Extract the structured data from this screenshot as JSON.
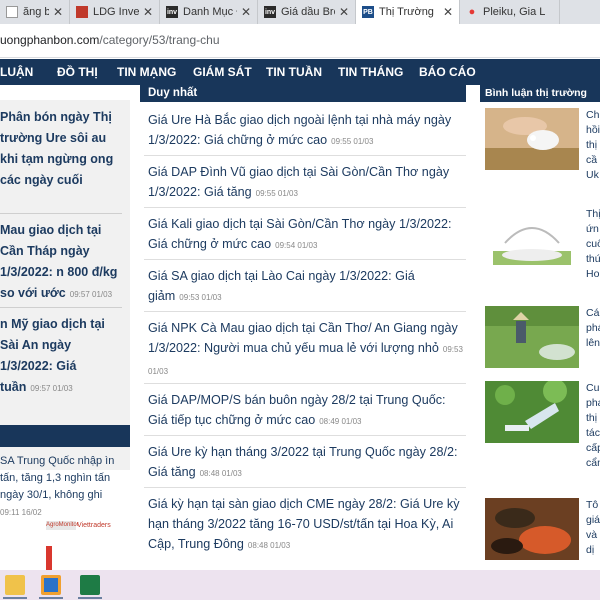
{
  "browser": {
    "tabs": [
      {
        "title": "ăng bài",
        "icon": "document-icon",
        "active": false
      },
      {
        "title": "LDG Investr",
        "icon": "ldg-icon",
        "active": false
      },
      {
        "title": "Danh Mục Đ",
        "icon": "inv-icon",
        "active": false
      },
      {
        "title": "Giá dầu Bre",
        "icon": "inv-icon",
        "active": false
      },
      {
        "title": "Thị Trường",
        "icon": "pb-icon",
        "active": true
      },
      {
        "title": "Pleiku, Gia L",
        "icon": "maps-pin-icon",
        "active": false
      }
    ],
    "url_host": "uongphanbon.com",
    "url_path": "/category/53/trang-chu"
  },
  "nav": {
    "items": [
      "LUẬN",
      "ĐỒ THỊ",
      "TIN MẠNG",
      "GIÁM SÁT",
      "TIN TUẦN",
      "TIN THÁNG",
      "BÁO CÁO"
    ]
  },
  "left": {
    "items": [
      {
        "text": "Phân bón ngày Thị trường Ure sôi au khi tạm ngừng ong các ngày cuối",
        "time": ""
      },
      {
        "text": "Mau giao dịch tại Cần Tháp ngày 1/3/2022: n 800 đ/kg so với ước",
        "time": "09:57 01/03"
      },
      {
        "text": "n Mỹ giao dịch tại Sài An ngày 1/3/2022: Giá tuần",
        "time": "09:57 01/03"
      }
    ],
    "small_text": "SA Trung Quốc nhập ìn tấn, tăng 1,3 nghìn tấn ngày 30/1, không ghi",
    "small_time": "09:11 16/02",
    "logo_a": "AgroMonitor",
    "logo_b": "Viettraders"
  },
  "main": {
    "header": "Duy nhất",
    "items": [
      {
        "text": "Giá Ure Hà Bắc giao dịch ngoài lệnh tại nhà máy ngày 1/3/2022: Giá chững ở mức cao",
        "time": "09:55 01/03"
      },
      {
        "text": "Giá DAP Đình Vũ giao dịch tại Sài Gòn/Cần Thơ ngày 1/3/2022: Giá tăng",
        "time": "09:55 01/03"
      },
      {
        "text": "Giá Kali giao dịch tại Sài Gòn/Cần Thơ ngày 1/3/2022: Giá chững ở mức cao",
        "time": "09:54 01/03"
      },
      {
        "text": "Giá SA giao dịch tại Lào Cai ngày 1/3/2022: Giá giảm",
        "time": "09:53 01/03"
      },
      {
        "text": "Giá NPK Cà Mau giao dịch tại Cần Thơ/ An Giang ngày 1/3/2022: Người mua chủ yếu mua lẻ với lượng nhỏ",
        "time": "09:53 01/03"
      },
      {
        "text": "Giá DAP/MOP/S bán buôn ngày 28/2 tại Trung Quốc: Giá tiếp tục chững ở mức cao",
        "time": "08:49 01/03"
      },
      {
        "text": "Giá Ure kỳ hạn tháng 3/2022 tại Trung Quốc ngày 28/2: Giá tăng",
        "time": "08:48 01/03"
      },
      {
        "text": "Giá kỳ hạn tại sàn giao dịch CME ngày 28/2: Giá Ure kỳ hạn tháng 3/2022 tăng 16-70 USD/st/tấn tại Hoa Kỳ, Ai Cập, Trung Đông",
        "time": "08:48 01/03"
      }
    ]
  },
  "right": {
    "header": "Bình luận thị trường",
    "items": [
      {
        "lines": [
          "Ch",
          "hồi",
          "thị",
          "cầ",
          "Uk"
        ]
      },
      {
        "lines": [
          "Thị",
          "ứn",
          "cuố",
          "thứ",
          "Ho"
        ]
      },
      {
        "lines": [
          "Cá",
          "phá",
          "lên"
        ]
      },
      {
        "lines": [
          "Cu",
          "pha",
          "thị",
          "tác",
          "cấp",
          "cẩn"
        ]
      },
      {
        "lines": [
          "Tô",
          "giá",
          "và",
          "dị"
        ]
      }
    ]
  },
  "taskbar": {
    "apps": [
      "file-explorer-icon",
      "outlook-icon",
      "excel-icon"
    ]
  }
}
